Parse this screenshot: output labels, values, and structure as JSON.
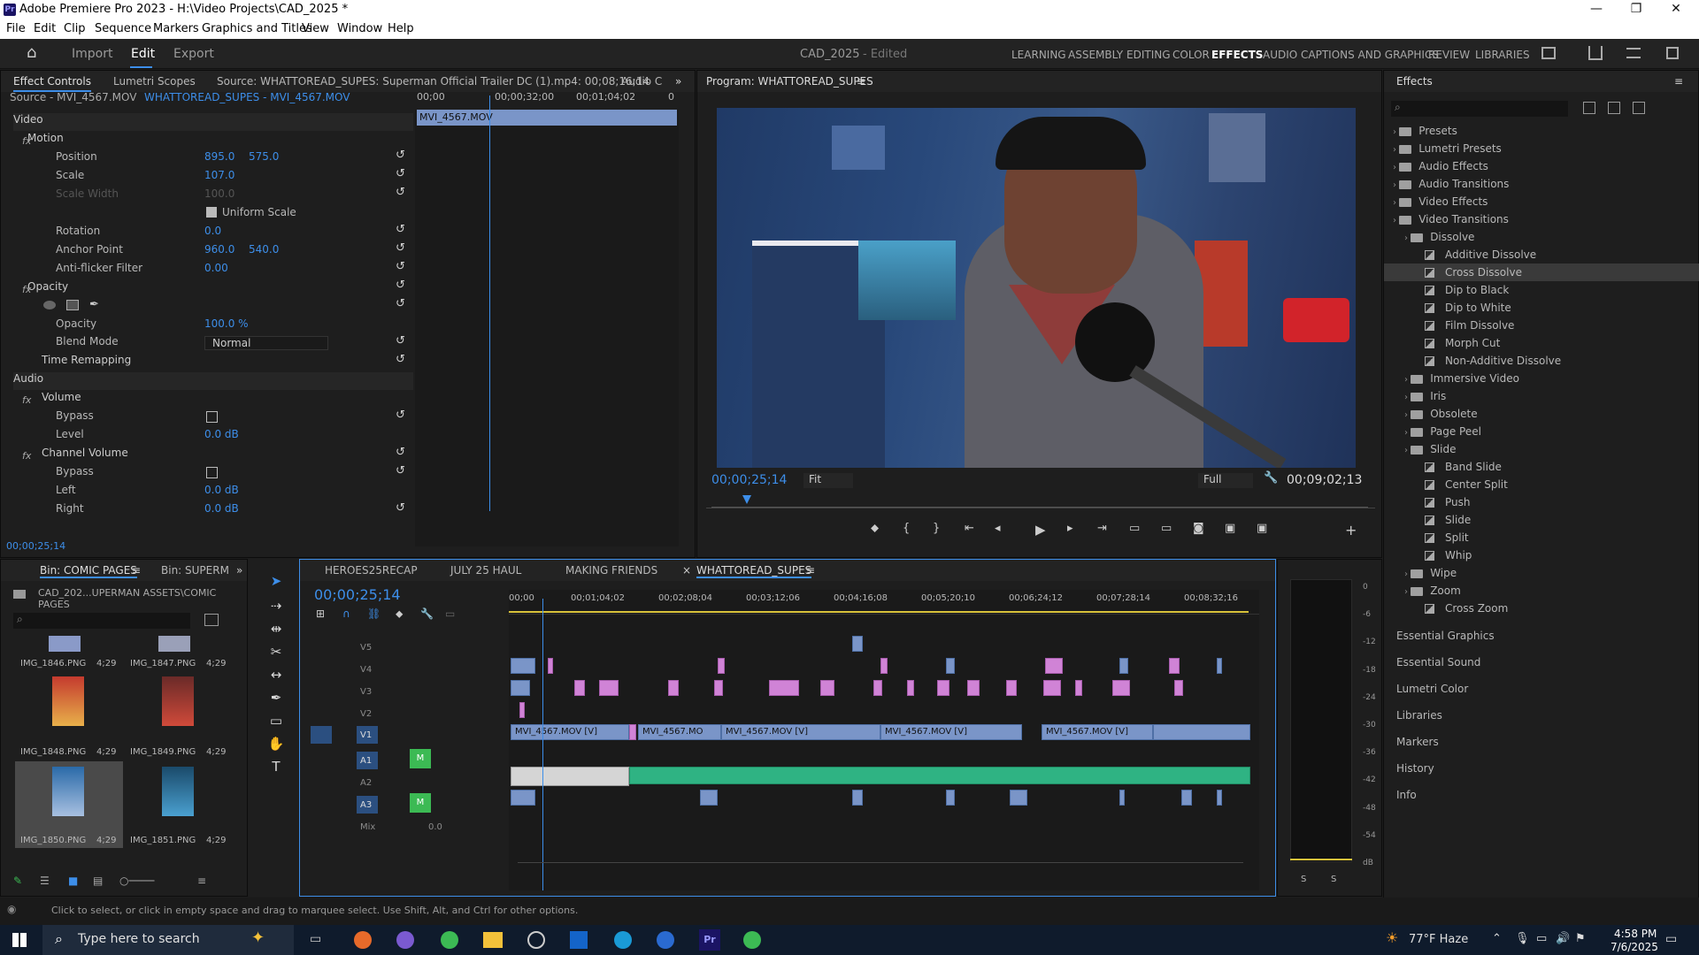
{
  "window": {
    "title": "Adobe Premiere Pro 2023 - H:\\Video Projects\\CAD_2025 *",
    "badge": "Pr",
    "minimize": "—",
    "maximize": "❐",
    "close": "✕"
  },
  "menu": [
    "File",
    "Edit",
    "Clip",
    "Sequence",
    "Markers",
    "Graphics and Titles",
    "View",
    "Window",
    "Help"
  ],
  "appbar": {
    "home": "⌂",
    "tabs": [
      "Import",
      "Edit",
      "Export"
    ],
    "project": "CAD_2025",
    "edited": "- Edited",
    "workspaces": [
      "LEARNING",
      "ASSEMBLY",
      "EDITING",
      "COLOR",
      "EFFECTS",
      "AUDIO",
      "CAPTIONS AND GRAPHICS",
      "REVIEW",
      "LIBRARIES"
    ]
  },
  "effect_controls": {
    "tabs": [
      "Effect Controls",
      "Lumetri Scopes",
      "Source: WHATTOREAD_SUPES: Superman Official Trailer DC (1).mp4: 00;08;16;14",
      "Audio C"
    ],
    "source": "Source - MVI_4567.MOV",
    "sequence": "WHATTOREAD_SUPES - MVI_4567.MOV",
    "ruler": [
      "00;00",
      "00;00;32;00",
      "00;01;04;02",
      "0"
    ],
    "clip": "MVI_4567.MOV",
    "video_label": "Video",
    "audio_label": "Audio",
    "rows": [
      {
        "label": "Motion",
        "v1": "",
        "v2": ""
      },
      {
        "label": "Position",
        "v1": "895.0",
        "v2": "575.0"
      },
      {
        "label": "Scale",
        "v1": "107.0",
        "v2": ""
      },
      {
        "label": "Scale Width",
        "v1": "100.0",
        "v2": ""
      },
      {
        "label": "Uniform Scale",
        "v1": "",
        "v2": ""
      },
      {
        "label": "Rotation",
        "v1": "0.0",
        "v2": ""
      },
      {
        "label": "Anchor Point",
        "v1": "960.0",
        "v2": "540.0"
      },
      {
        "label": "Anti-flicker Filter",
        "v1": "0.00",
        "v2": ""
      },
      {
        "label": "Opacity",
        "v1": "",
        "v2": ""
      },
      {
        "label": "Opacity",
        "v1": "100.0 %",
        "v2": ""
      },
      {
        "label": "Blend Mode",
        "v1": "Normal",
        "v2": ""
      },
      {
        "label": "Time Remapping",
        "v1": "",
        "v2": ""
      }
    ],
    "audio_rows": [
      {
        "label": "Volume",
        "v": ""
      },
      {
        "label": "Bypass",
        "v": ""
      },
      {
        "label": "Level",
        "v": "0.0 dB"
      },
      {
        "label": "Channel Volume",
        "v": ""
      },
      {
        "label": "Bypass",
        "v": ""
      },
      {
        "label": "Left",
        "v": "0.0 dB"
      },
      {
        "label": "Right",
        "v": "0.0 dB"
      }
    ],
    "timecode": "00;00;25;14"
  },
  "program": {
    "title": "Program: WHATTOREAD_SUPES",
    "timecode": "00;00;25;14",
    "fit": "Fit",
    "quality": "Full",
    "duration": "00;09;02;13",
    "playhead_fraction": 0.047
  },
  "effects": {
    "title": "Effects",
    "items": [
      {
        "label": "Presets",
        "type": "folder",
        "indent": 0
      },
      {
        "label": "Lumetri Presets",
        "type": "folder",
        "indent": 0
      },
      {
        "label": "Audio Effects",
        "type": "folder",
        "indent": 0
      },
      {
        "label": "Audio Transitions",
        "type": "folder",
        "indent": 0
      },
      {
        "label": "Video Effects",
        "type": "folder",
        "indent": 0
      },
      {
        "label": "Video Transitions",
        "type": "folder",
        "indent": 0
      },
      {
        "label": "Dissolve",
        "type": "folder",
        "indent": 1
      },
      {
        "label": "Additive Dissolve",
        "type": "fx",
        "indent": 2
      },
      {
        "label": "Cross Dissolve",
        "type": "fx",
        "indent": 2
      },
      {
        "label": "Dip to Black",
        "type": "fx",
        "indent": 2
      },
      {
        "label": "Dip to White",
        "type": "fx",
        "indent": 2
      },
      {
        "label": "Film Dissolve",
        "type": "fx",
        "indent": 2
      },
      {
        "label": "Morph Cut",
        "type": "fx",
        "indent": 2
      },
      {
        "label": "Non-Additive Dissolve",
        "type": "fx",
        "indent": 2
      },
      {
        "label": "Immersive Video",
        "type": "folder",
        "indent": 1
      },
      {
        "label": "Iris",
        "type": "folder",
        "indent": 1
      },
      {
        "label": "Obsolete",
        "type": "folder",
        "indent": 1
      },
      {
        "label": "Page Peel",
        "type": "folder",
        "indent": 1
      },
      {
        "label": "Slide",
        "type": "folder",
        "indent": 1
      },
      {
        "label": "Band Slide",
        "type": "fx",
        "indent": 2
      },
      {
        "label": "Center Split",
        "type": "fx",
        "indent": 2
      },
      {
        "label": "Push",
        "type": "fx",
        "indent": 2
      },
      {
        "label": "Slide",
        "type": "fx",
        "indent": 2
      },
      {
        "label": "Split",
        "type": "fx",
        "indent": 2
      },
      {
        "label": "Whip",
        "type": "fx",
        "indent": 2
      },
      {
        "label": "Wipe",
        "type": "folder",
        "indent": 1
      },
      {
        "label": "Zoom",
        "type": "folder",
        "indent": 1
      },
      {
        "label": "Cross Zoom",
        "type": "fx",
        "indent": 2
      }
    ],
    "panels": [
      "Essential Graphics",
      "Essential Sound",
      "Lumetri Color",
      "Libraries",
      "Markers",
      "History",
      "Info"
    ]
  },
  "bin": {
    "tabs": [
      "Bin: COMIC PAGES",
      "Bin: SUPERM"
    ],
    "path": "CAD_202...UPERMAN ASSETS\\COMIC PAGES",
    "items": [
      {
        "name": "IMG_1846.PNG",
        "dur": "4;29"
      },
      {
        "name": "IMG_1847.PNG",
        "dur": "4;29"
      },
      {
        "name": "IMG_1848.PNG",
        "dur": "4;29"
      },
      {
        "name": "IMG_1849.PNG",
        "dur": "4;29"
      },
      {
        "name": "IMG_1850.PNG",
        "dur": "4;29"
      },
      {
        "name": "IMG_1851.PNG",
        "dur": "4;29"
      }
    ]
  },
  "timeline": {
    "tabs": [
      "HEROES25RECAP",
      "JULY 25 HAUL",
      "MAKING FRIENDS",
      "WHATTOREAD_SUPES"
    ],
    "timecode": "00;00;25;14",
    "ruler": [
      "00;00",
      "00;01;04;02",
      "00;02;08;04",
      "00;03;12;06",
      "00;04;16;08",
      "00;05;20;10",
      "00;06;24;12",
      "00;07;28;14",
      "00;08;32;16"
    ],
    "tracks": [
      "V5",
      "V4",
      "V3",
      "V2",
      "V1",
      "A1",
      "A2",
      "A3"
    ],
    "mix_label": "Mix",
    "mix_value": "0.0",
    "clips": [
      "MVI_4567.MOV [V]",
      "MVI_4567.MO",
      "MVI_4567.MOV [V]",
      "MVI_4567.MOV [V]",
      "MVI_4567.MOV [V]"
    ]
  },
  "meter": {
    "scale": [
      "0",
      "-6",
      "-12",
      "-18",
      "-24",
      "-30",
      "-36",
      "-42",
      "-48",
      "-54",
      "dB"
    ],
    "solo": [
      "S",
      "S"
    ]
  },
  "status": "Click to select, or click in empty space and drag to marquee select. Use Shift, Alt, and Ctrl for other options.",
  "taskbar": {
    "search": "Type here to search",
    "weather": "77°F Haze",
    "time": "4:58 PM",
    "date": "7/6/2025"
  }
}
